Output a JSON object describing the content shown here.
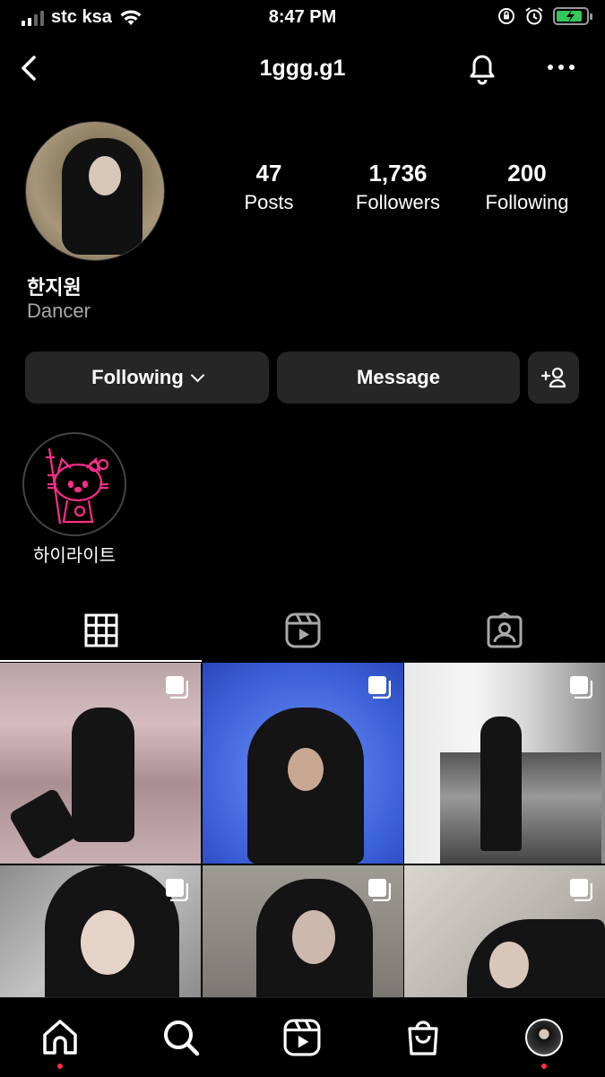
{
  "status_bar": {
    "carrier": "stc ksa",
    "time": "8:47 PM"
  },
  "header": {
    "username": "1ggg.g1"
  },
  "profile": {
    "stats": [
      {
        "num": "47",
        "label": "Posts"
      },
      {
        "num": "1,736",
        "label": "Followers"
      },
      {
        "num": "200",
        "label": "Following"
      }
    ],
    "name": "한지원",
    "bio": "Dancer"
  },
  "actions": {
    "following_label": "Following",
    "message_label": "Message"
  },
  "highlights": [
    {
      "label": "하이라이트"
    }
  ],
  "tabs": [
    {
      "icon": "grid-icon",
      "active": true
    },
    {
      "icon": "reels-icon",
      "active": false
    },
    {
      "icon": "tagged-icon",
      "active": false
    }
  ],
  "nav": [
    {
      "icon": "home-icon"
    },
    {
      "icon": "search-icon"
    },
    {
      "icon": "reels-icon"
    },
    {
      "icon": "shop-icon"
    },
    {
      "icon": "profile-avatar"
    }
  ],
  "colors": {
    "background": "#000000",
    "button": "#262626",
    "muted_text": "#a8a8a8",
    "notification_dot": "#ff3040",
    "highlight_pink": "#ff2d8a"
  }
}
